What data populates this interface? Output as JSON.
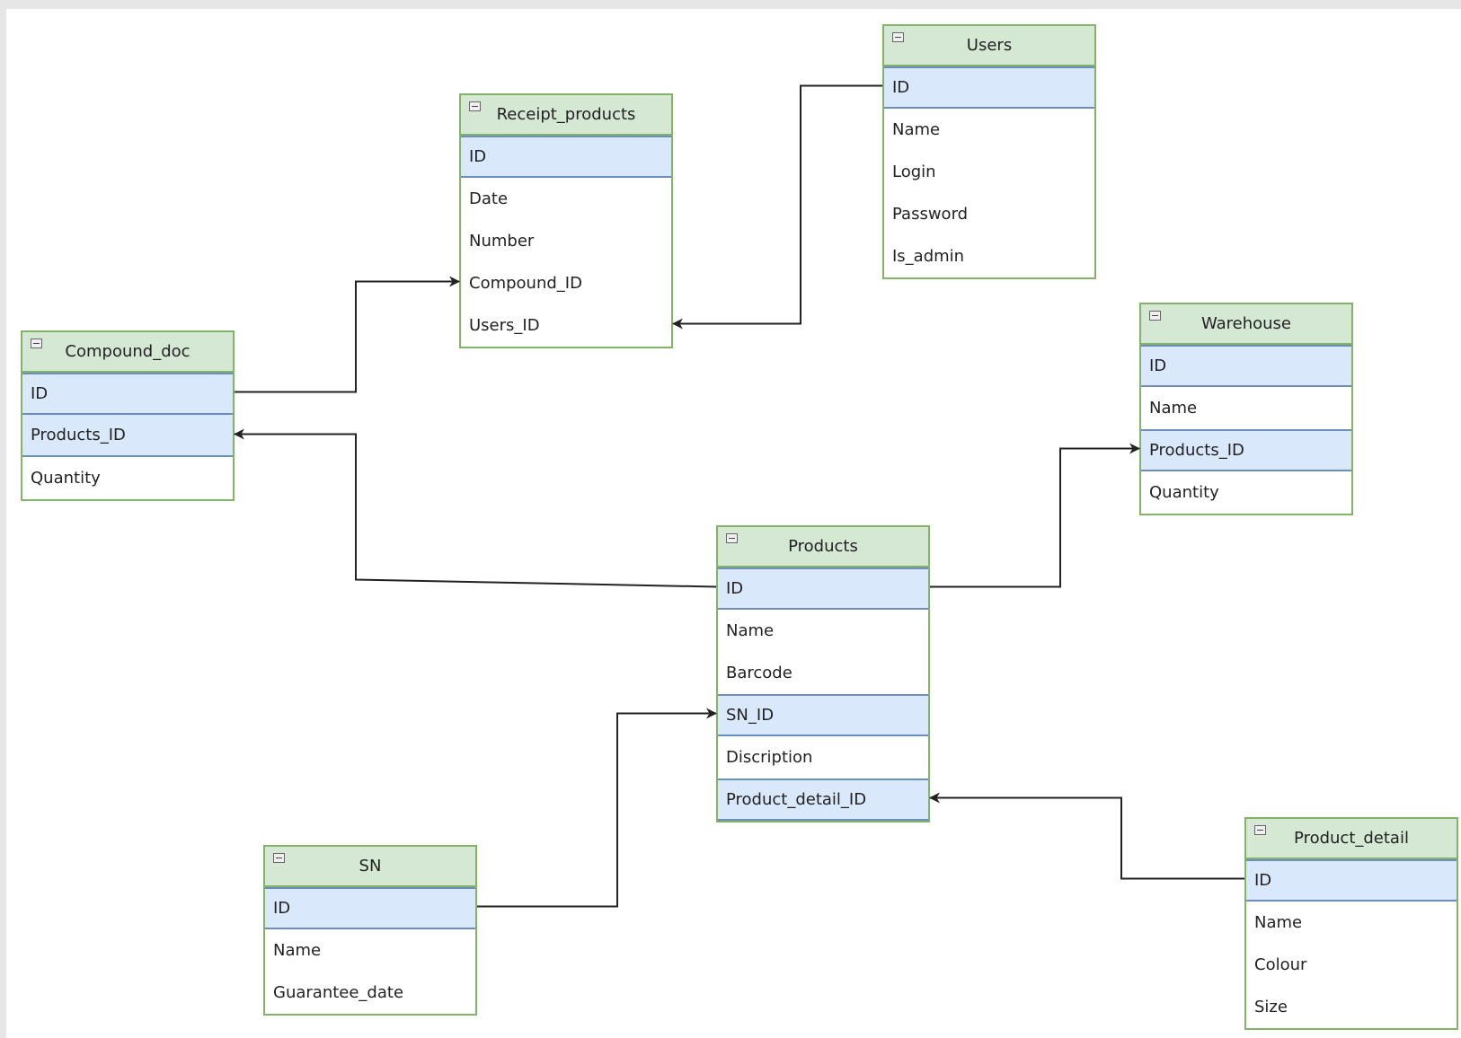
{
  "tables": {
    "receipt_products": {
      "title": "Receipt_products",
      "fields": [
        {
          "label": "ID",
          "key": true
        },
        {
          "label": "Date",
          "key": false
        },
        {
          "label": "Number",
          "key": false
        },
        {
          "label": "Compound_ID",
          "key": false
        },
        {
          "label": "Users_ID",
          "key": false
        }
      ]
    },
    "users": {
      "title": "Users",
      "fields": [
        {
          "label": "ID",
          "key": true
        },
        {
          "label": "Name",
          "key": false
        },
        {
          "label": "Login",
          "key": false
        },
        {
          "label": "Password",
          "key": false
        },
        {
          "label": "Is_admin",
          "key": false
        }
      ]
    },
    "compound_doc": {
      "title": "Compound_doc",
      "fields": [
        {
          "label": "ID",
          "key": true
        },
        {
          "label": "Products_ID",
          "key": true
        },
        {
          "label": "Quantity",
          "key": false
        }
      ]
    },
    "warehouse": {
      "title": "Warehouse",
      "fields": [
        {
          "label": "ID",
          "key": true
        },
        {
          "label": "Name",
          "key": false
        },
        {
          "label": "Products_ID",
          "key": true
        },
        {
          "label": "Quantity",
          "key": false
        }
      ]
    },
    "products": {
      "title": "Products",
      "fields": [
        {
          "label": "ID",
          "key": true
        },
        {
          "label": "Name",
          "key": false
        },
        {
          "label": "Barcode",
          "key": false
        },
        {
          "label": "SN_ID",
          "key": true
        },
        {
          "label": "Discription",
          "key": false
        },
        {
          "label": "Product_detail_ID",
          "key": true
        }
      ]
    },
    "sn": {
      "title": "SN",
      "fields": [
        {
          "label": "ID",
          "key": true
        },
        {
          "label": "Name",
          "key": false
        },
        {
          "label": "Guarantee_date",
          "key": false
        }
      ]
    },
    "product_detail": {
      "title": "Product_detail",
      "fields": [
        {
          "label": "ID",
          "key": true
        },
        {
          "label": "Name",
          "key": false
        },
        {
          "label": "Colour",
          "key": false
        },
        {
          "label": "Size",
          "key": false
        }
      ]
    }
  },
  "relations": [
    {
      "from": "compound_doc.ID",
      "to": "receipt_products.Compound_ID"
    },
    {
      "from": "users.ID",
      "to": "receipt_products.Users_ID"
    },
    {
      "from": "products.ID",
      "to": "compound_doc.Products_ID"
    },
    {
      "from": "products.ID",
      "to": "warehouse.Products_ID"
    },
    {
      "from": "sn.ID",
      "to": "products.SN_ID"
    },
    {
      "from": "product_detail.ID",
      "to": "products.Product_detail_ID"
    }
  ],
  "colors": {
    "header_fill": "#d5e8d4",
    "header_border": "#82b366",
    "key_fill": "#dae8fc",
    "key_border": "#6c8ebf",
    "edge": "#222222"
  },
  "icons": {
    "collapse": "collapse-icon"
  }
}
